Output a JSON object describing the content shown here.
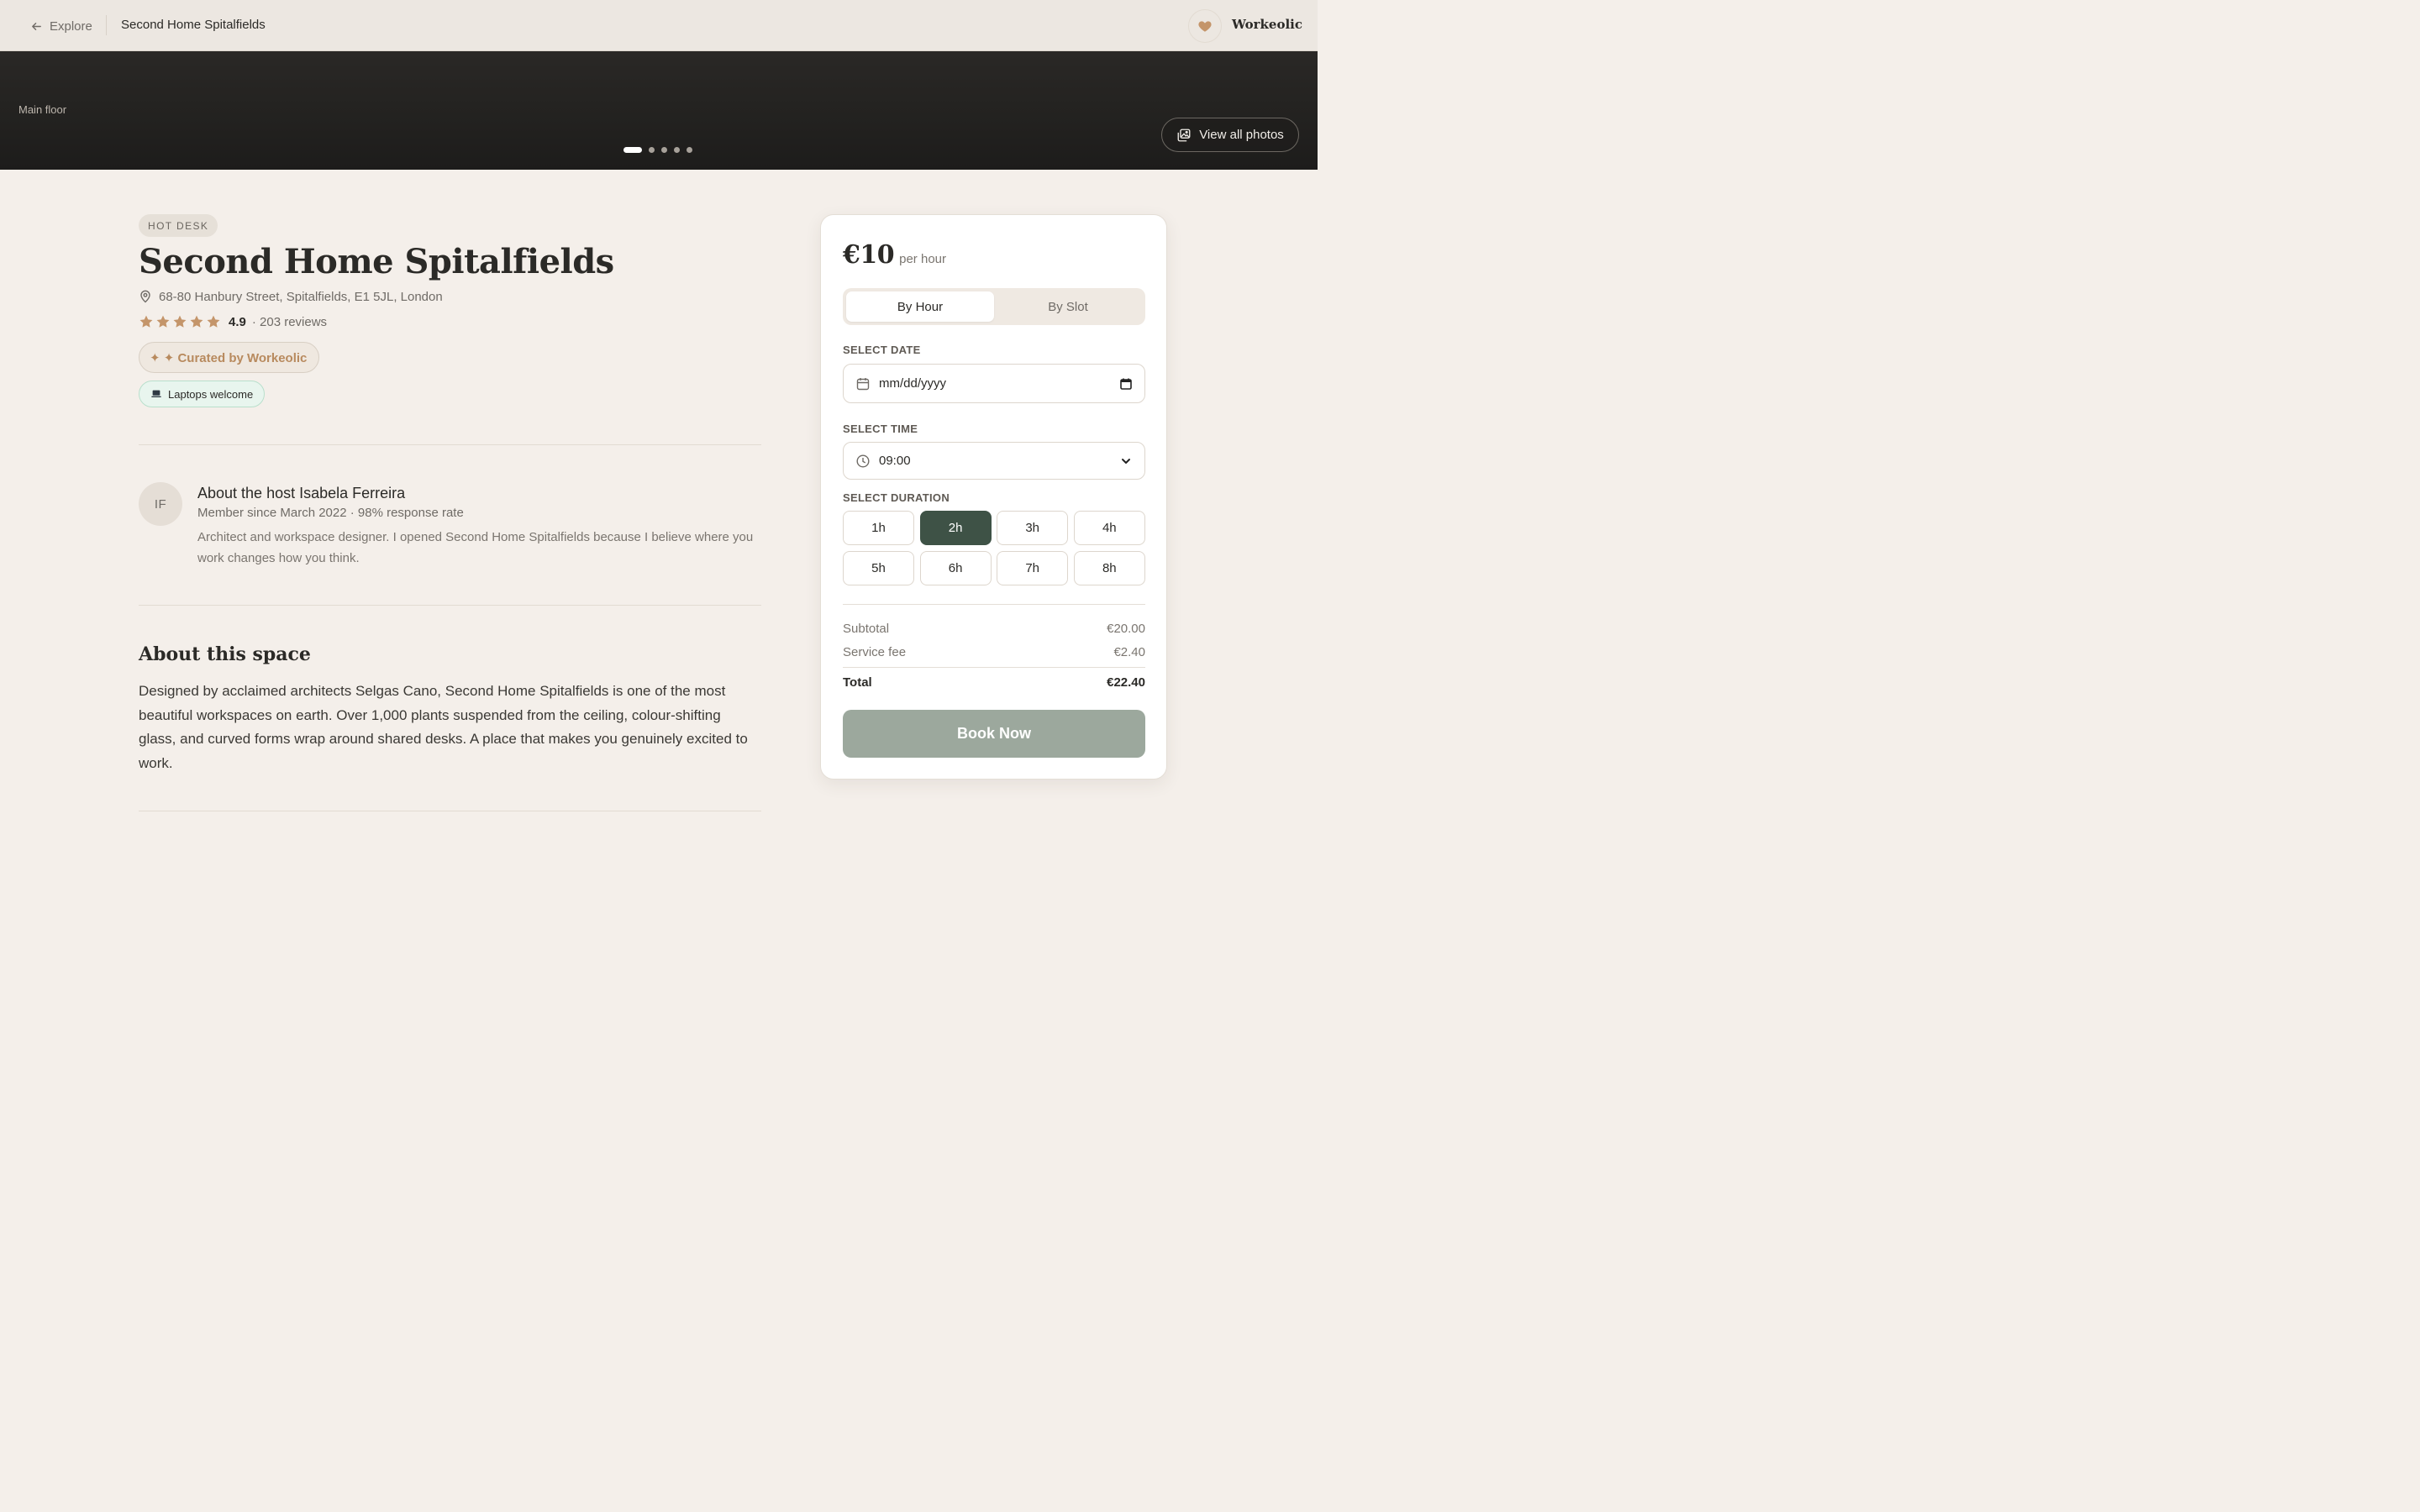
{
  "topbar": {
    "back_label": "Explore",
    "page_title": "Second Home Spitalfields",
    "brand": "Workeolic"
  },
  "hero": {
    "label": "Main floor",
    "view_photos_label": "View all photos",
    "photo_count": 5,
    "active_photo": 1
  },
  "listing": {
    "type_badge": "HOT DESK",
    "title": "Second Home Spitalfields",
    "address": "68-80 Hanbury Street, Spitalfields, E1 5JL, London",
    "rating": "4.9",
    "rating_stars": 5,
    "reviews": "· 203 reviews",
    "curated_label": "✦ ✦ Curated by Workeolic",
    "amenity_label": "Laptops welcome"
  },
  "host": {
    "initials": "IF",
    "title": "About the host Isabela Ferreira",
    "meta": "Member since March 2022 · 98% response rate",
    "bio": "Architect and workspace designer. I opened Second Home Spitalfields because I believe where you work changes how you think."
  },
  "about": {
    "heading": "About this space",
    "text": "Designed by acclaimed architects Selgas Cano, Second Home Spitalfields is one of the most beautiful workspaces on earth. Over 1,000 plants suspended from the ceiling, colour-shifting glass, and curved forms wrap around shared desks. A place that makes you genuinely excited to work."
  },
  "booking": {
    "price": "€10",
    "price_unit": "per hour",
    "modes": [
      "By Hour",
      "By Slot"
    ],
    "active_mode": "By Hour",
    "date_label": "SELECT DATE",
    "date_placeholder": "mm/dd/yyyy",
    "time_label": "SELECT TIME",
    "time_value": "09:00",
    "duration_label": "SELECT DURATION",
    "durations": [
      "1h",
      "2h",
      "3h",
      "4h",
      "5h",
      "6h",
      "7h",
      "8h"
    ],
    "active_duration": "2h",
    "subtotal_label": "Subtotal",
    "subtotal_value": "€20.00",
    "fee_label": "Service fee",
    "fee_value": "€2.40",
    "total_label": "Total",
    "total_value": "€22.40",
    "cta_label": "Book Now"
  },
  "colors": {
    "background": "#f4efea",
    "accent": "#c4956a",
    "active_duration": "#3e5246",
    "cta": "#9ca89d"
  }
}
